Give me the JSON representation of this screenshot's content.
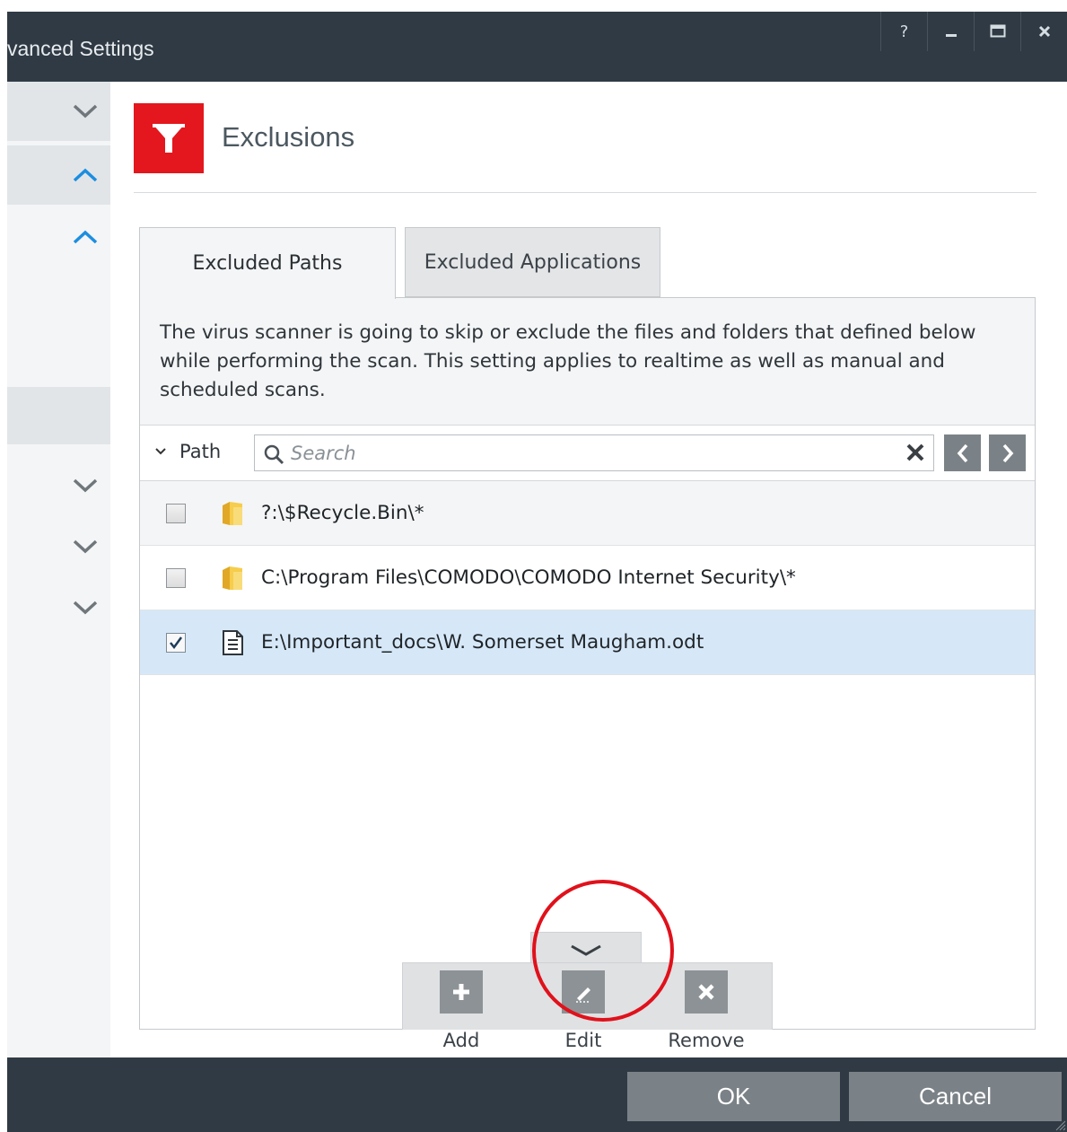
{
  "window": {
    "title": "vanced Settings",
    "controls": {
      "help": "?"
    }
  },
  "section": {
    "title": "Exclusions",
    "icon": "funnel-icon",
    "accent": "#e3171d"
  },
  "tabs": [
    {
      "label": "Excluded Paths",
      "active": true
    },
    {
      "label": "Excluded Applications",
      "active": false
    }
  ],
  "description": "The virus scanner is going to skip or exclude the files and folders that defined below while performing the scan. This setting applies to realtime as well as manual and scheduled scans.",
  "filter": {
    "column_label": "Path",
    "search_placeholder": "Search",
    "search_value": ""
  },
  "rows": [
    {
      "path": "?:\\$Recycle.Bin\\*",
      "icon": "folder-icon",
      "checked": false
    },
    {
      "path": "C:\\Program Files\\COMODO\\COMODO Internet Security\\*",
      "icon": "folder-icon",
      "checked": false
    },
    {
      "path": "E:\\Important_docs\\W. Somerset Maugham.odt",
      "icon": "document-icon",
      "checked": true
    }
  ],
  "actions": {
    "add": "Add",
    "edit": "Edit",
    "remove": "Remove"
  },
  "footer": {
    "ok": "OK",
    "cancel": "Cancel"
  }
}
